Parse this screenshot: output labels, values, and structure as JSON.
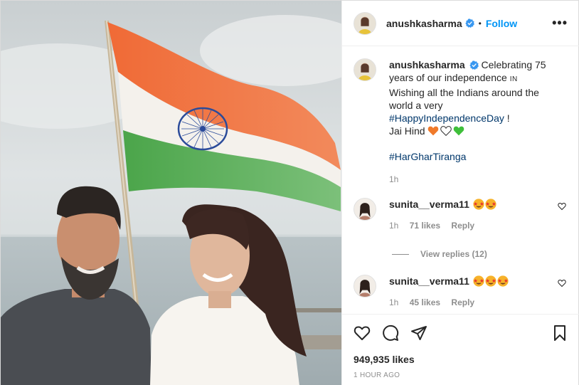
{
  "header": {
    "username": "anushkasharma",
    "separator": "•",
    "follow_label": "Follow",
    "more_label": "•••"
  },
  "caption": {
    "username": "anushkasharma",
    "text_1": "Celebrating 75 years of our independence",
    "flag_text": "IN",
    "text_2": "Wishing all the Indians around the world a very",
    "hashtag_1": "#HappyIndependenceDay",
    "text_3": "!",
    "text_4": "Jai Hind",
    "hashtag_2": "#HarGharTiranga",
    "time": "1h"
  },
  "comments": [
    {
      "username": "sunita__verma11",
      "emoji_count": 2,
      "time": "1h",
      "likes": "71 likes",
      "reply": "Reply"
    },
    {
      "username": "sunita__verma11",
      "emoji_count": 3,
      "time": "1h",
      "likes": "45 likes",
      "reply": "Reply"
    }
  ],
  "view_replies": "View replies (12)",
  "actions": {
    "likes": "949,935 likes",
    "posted": "1 HOUR AGO"
  },
  "colors": {
    "link_blue": "#0095f6",
    "hashtag": "#00376b",
    "muted": "#8e8e8e",
    "saffron": "#f0703a",
    "green": "#3fa845"
  },
  "icons": [
    "verified-badge-icon",
    "more-options-icon",
    "heart-icon",
    "comment-icon",
    "share-icon",
    "bookmark-icon"
  ]
}
